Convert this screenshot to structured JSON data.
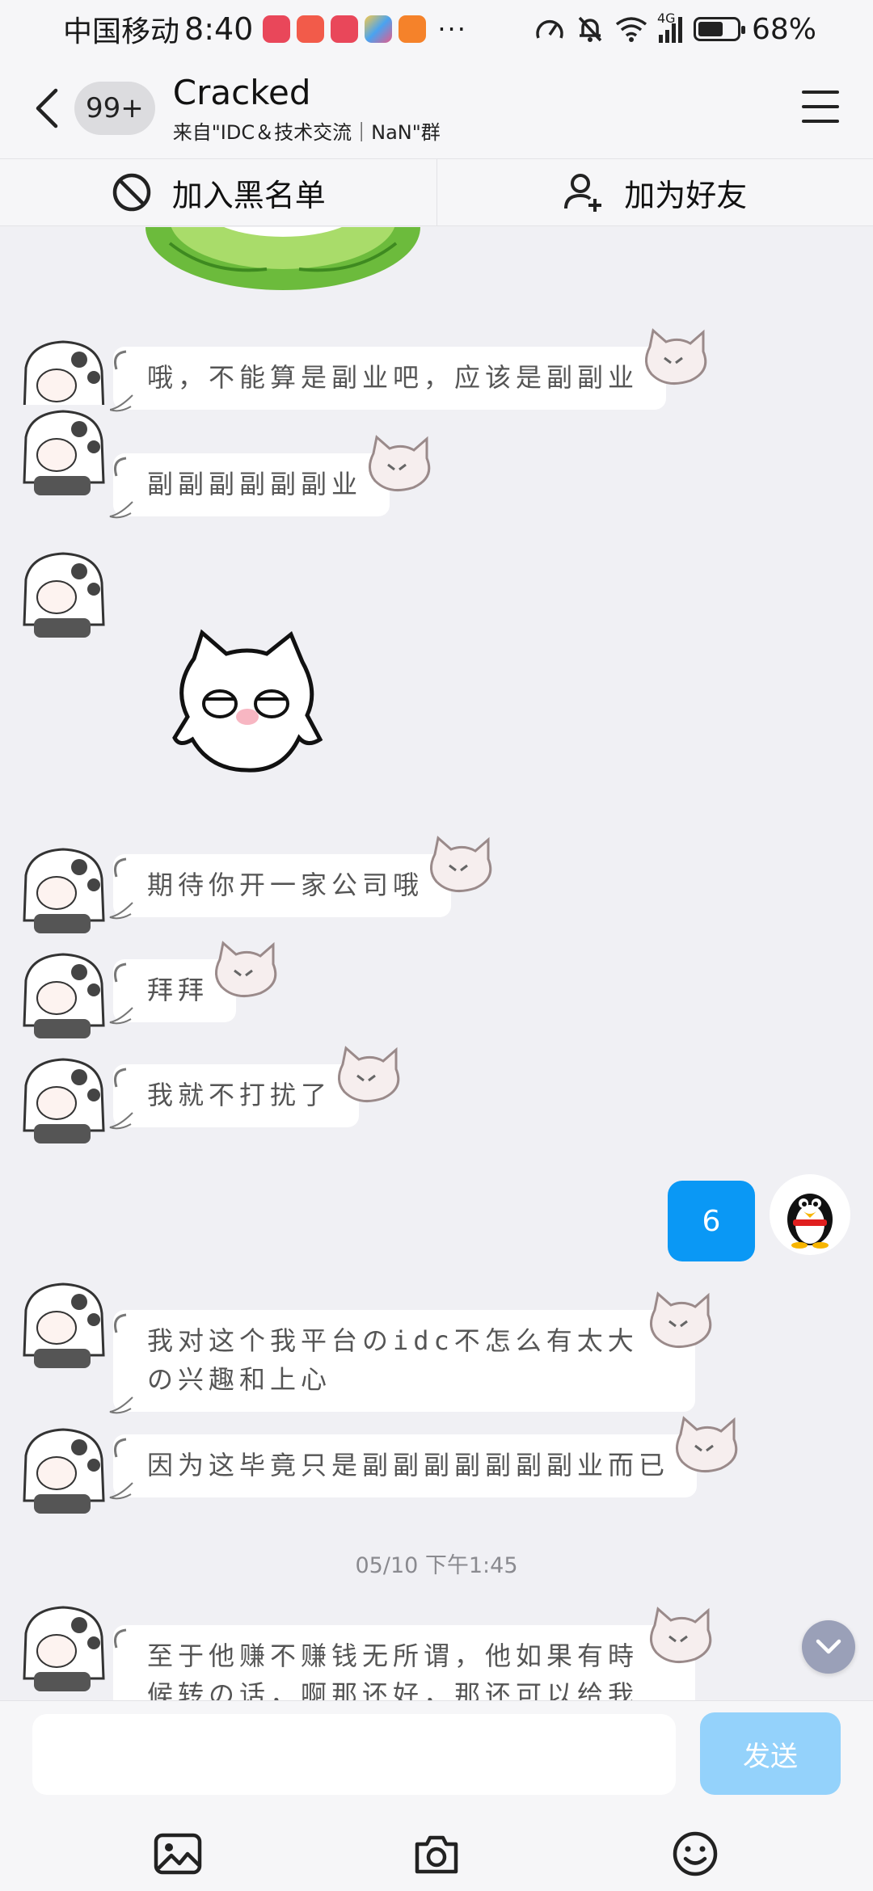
{
  "status_bar": {
    "carrier": "中国移动",
    "time": "8:40",
    "more": "···",
    "network": "4G",
    "battery": "68%"
  },
  "header": {
    "unread_badge": "99+",
    "title": "Cracked",
    "subtitle": "来自\"IDC＆技术交流｜NaN\"群"
  },
  "actions": {
    "block_label": "加入黑名单",
    "add_friend_label": "加为好友"
  },
  "messages": [
    {
      "text": "哦，不能算是副业吧，应该是副副业"
    },
    {
      "text": "副副副副副副业"
    },
    {
      "text": "期待你开一家公司哦"
    },
    {
      "text": "拜拜"
    },
    {
      "text": "我就不打扰了"
    },
    {
      "text": "6",
      "mine": true
    },
    {
      "text": "我对这个我平台のidc不怎么有太大の兴趣和上心"
    },
    {
      "text": "因为这毕竟只是副副副副副副副业而已"
    },
    {
      "text": "至于他赚不赚钱无所谓，他如果有時候转の话，啊那还好，那还可以给我带来"
    }
  ],
  "timestamp": "05/10 下午1:45",
  "composer": {
    "placeholder": "",
    "send_label": "发送"
  },
  "icons": {
    "back": "chevron-left-icon",
    "menu": "hamburger-icon",
    "block": "ban-icon",
    "add_friend": "add-user-icon",
    "image": "image-icon",
    "camera": "camera-icon",
    "emoji": "emoji-icon",
    "scroll_down": "chevron-down-icon"
  },
  "colors": {
    "accent": "#0a98f5",
    "send_disabled": "#94d2fb",
    "background": "#f0f0f4"
  }
}
